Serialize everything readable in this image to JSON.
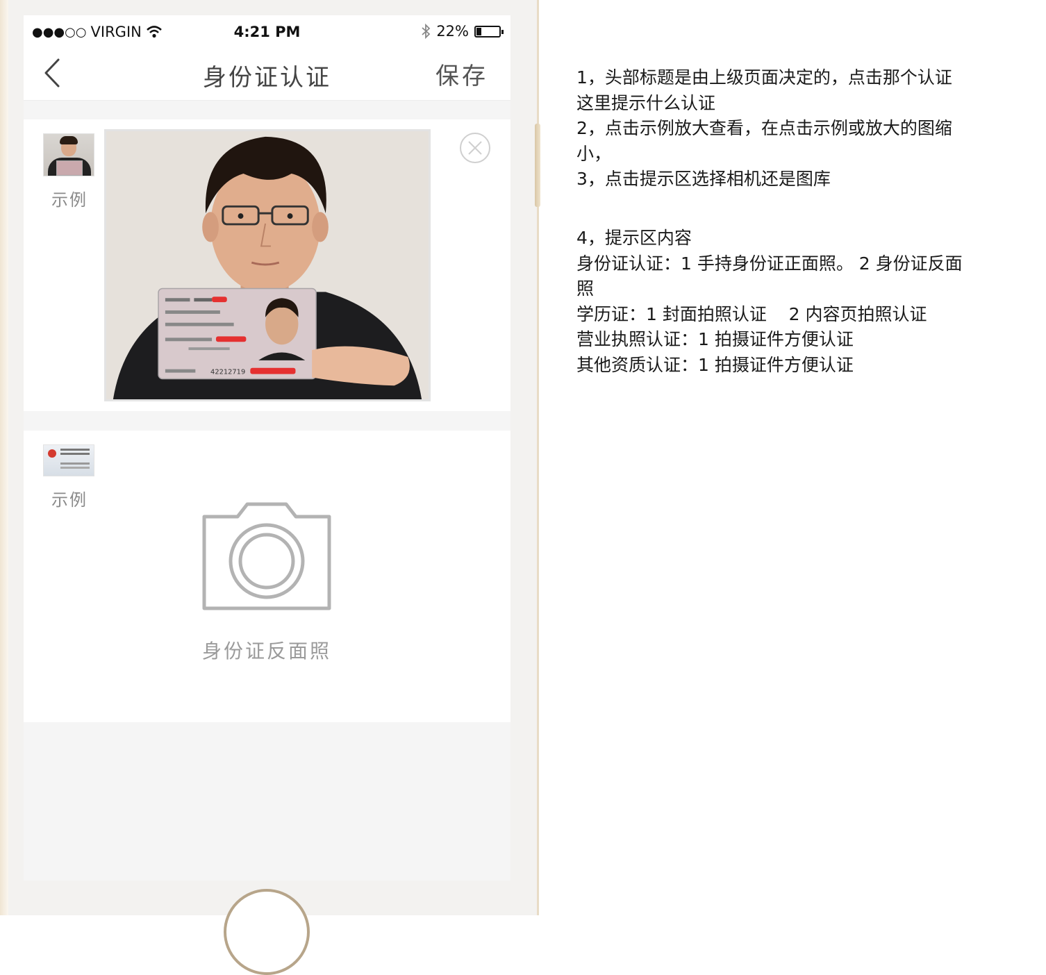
{
  "status_bar": {
    "signal": "●●●○○",
    "carrier": "VIRGIN",
    "time": "4:21 PM",
    "battery_text": "22%",
    "battery_level": 0.22
  },
  "nav": {
    "title": "身份证认证",
    "save_label": "保存"
  },
  "front_section": {
    "example_label": "示例"
  },
  "back_section": {
    "example_label": "示例",
    "upload_label": "身份证反面照"
  },
  "id_card": {
    "number_fragment": "42212719"
  },
  "notes": {
    "line1": "1，头部标题是由上级页面决定的，点击那个认证",
    "line2": "这里提示什么认证",
    "line3": "2，点击示例放大查看，在点击示例或放大的图缩",
    "line4": "小，",
    "line5": "3，点击提示区选择相机还是图库",
    "line6": "4，提示区内容",
    "line7": "身份证认证：1 手持身份证正面照。 2 身份证反面",
    "line8": "照",
    "line9": "学历证：1 封面拍照认证    2 内容页拍照认证",
    "line10": "营业执照认证：1 拍摄证件方便认证",
    "line11": "其他资质认证：1 拍摄证件方便认证"
  }
}
